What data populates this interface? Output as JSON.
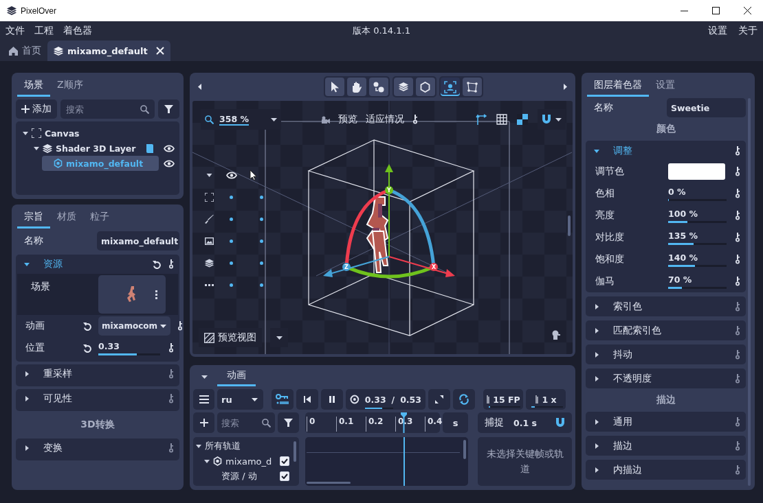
{
  "window": {
    "title": "PixelOver"
  },
  "menu": {
    "left": [
      {
        "label": "文件"
      },
      {
        "label": "工程"
      },
      {
        "label": "着色器"
      }
    ],
    "version": "版本 0.14.1.1",
    "right": [
      {
        "label": "设置"
      },
      {
        "label": "关于"
      }
    ]
  },
  "doc_tabs": [
    {
      "label": "首页",
      "kind": "home",
      "selected": false,
      "closable": false
    },
    {
      "label": "mixamo_default",
      "kind": "layers",
      "selected": true,
      "closable": true
    }
  ],
  "scene_panel": {
    "tabs": [
      {
        "label": "场景",
        "selected": true
      },
      {
        "label": "Z顺序",
        "selected": false
      }
    ],
    "add_button": "添加",
    "search": {
      "placeholder": "搜索"
    },
    "tree": [
      {
        "label": "Canvas",
        "kind": "canvas",
        "expanded": true,
        "selected": false,
        "children": [
          {
            "label": "Shader 3D Layer",
            "kind": "layer",
            "expanded": true,
            "selected": false,
            "visible": true,
            "shader": true,
            "children": [
              {
                "label": "mixamo_default",
                "kind": "model",
                "selected": true,
                "visible": true
              }
            ]
          }
        ]
      }
    ]
  },
  "props_panel": {
    "tabs": [
      {
        "label": "宗旨",
        "selected": true
      },
      {
        "label": "材质",
        "selected": false
      },
      {
        "label": "粒子",
        "selected": false
      }
    ],
    "name": {
      "label": "名称",
      "value": "mixamo_default"
    },
    "sections": [
      {
        "kind": "group",
        "title": "资源",
        "expanded": true,
        "resettable": true,
        "rows": [
          {
            "kind": "thumbnail",
            "label": "场景"
          },
          {
            "kind": "dropdown",
            "label": "动画",
            "value": "mixamocom",
            "resettable": true
          },
          {
            "kind": "slider",
            "label": "位置",
            "value": "0.33",
            "level": 0.62,
            "resettable": true
          }
        ]
      },
      {
        "kind": "group",
        "title": "重采样",
        "expanded": false
      },
      {
        "kind": "group",
        "title": "可见性",
        "expanded": false
      },
      {
        "kind": "header",
        "title": "3D转换"
      },
      {
        "kind": "group",
        "title": "变换",
        "expanded": false
      }
    ]
  },
  "viewport": {
    "tool_groups": [
      {
        "tools": [
          {
            "kind": "pointer",
            "selected": false
          },
          {
            "kind": "hand",
            "selected": false
          },
          {
            "kind": "bones",
            "selected": false
          }
        ]
      },
      {
        "tools": [
          {
            "kind": "layers",
            "selected": false
          },
          {
            "kind": "hexagon",
            "selected": false
          }
        ]
      },
      {
        "tools": [
          {
            "kind": "frame",
            "selected": true
          },
          {
            "kind": "polygon",
            "selected": false
          }
        ]
      }
    ],
    "zoom": {
      "value": "358 %"
    },
    "preview_label": "预览",
    "fit_label": "适应情况",
    "toggles": [
      {
        "kind": "axes",
        "on": true
      },
      {
        "kind": "grid",
        "on": false
      },
      {
        "kind": "checker",
        "on": true
      }
    ],
    "magnet": {
      "on": true
    },
    "view_mode": "预览视图",
    "gizmo_axes": [
      {
        "label": "Y"
      },
      {
        "label": "Z"
      },
      {
        "label": "X"
      }
    ]
  },
  "animation_panel": {
    "tabs": [
      {
        "label": "动画",
        "selected": true
      }
    ],
    "animation": "ru",
    "record": true,
    "time": {
      "current": "0.33",
      "separator": "/",
      "total": "0.53",
      "level": 0.62
    },
    "loop": true,
    "fps": {
      "value": "15 FP",
      "level": 0.05
    },
    "speed": {
      "value": "1 x",
      "level": 0.1
    },
    "search": {
      "placeholder": "搜索"
    },
    "ruler": {
      "ticks": [
        "0",
        "0.1",
        "0.2",
        "0.3",
        "0.4"
      ],
      "level": 0.73
    },
    "unit": "s",
    "snap": {
      "label": "捕捉",
      "value": "0.1 s",
      "on": true
    },
    "tracks": [
      {
        "label": "所有轨道",
        "expanded": true,
        "children": [
          {
            "label": "mixamo_d",
            "kind": "model",
            "expanded": true,
            "checked": true,
            "children": [
              {
                "label": "资源 / 动",
                "checked": true
              }
            ]
          }
        ]
      }
    ],
    "empty_message": "未选择关键帧或轨道"
  },
  "shader_panel": {
    "tabs": [
      {
        "label": "图层着色器",
        "selected": true
      },
      {
        "label": "设置",
        "selected": false
      }
    ],
    "name": {
      "label": "名称",
      "value": "Sweetie"
    },
    "sections": [
      {
        "kind": "header",
        "title": "颜色"
      },
      {
        "kind": "group",
        "title": "调整",
        "expanded": true,
        "rows": [
          {
            "kind": "color",
            "label": "调节色",
            "color": "#ffffff"
          },
          {
            "kind": "slider",
            "label": "色相",
            "value": "0 %",
            "level": 0
          },
          {
            "kind": "slider",
            "label": "亮度",
            "value": "100 %",
            "level": 0.33
          },
          {
            "kind": "slider",
            "label": "对比度",
            "value": "135 %",
            "level": 0.44
          },
          {
            "kind": "slider",
            "label": "饱和度",
            "value": "140 %",
            "level": 0.46
          },
          {
            "kind": "slider",
            "label": "伽马",
            "value": "70 %",
            "level": 0.23
          }
        ]
      },
      {
        "kind": "group",
        "title": "索引色",
        "expanded": false
      },
      {
        "kind": "group",
        "title": "匹配索引色",
        "expanded": false
      },
      {
        "kind": "group",
        "title": "抖动",
        "expanded": false
      },
      {
        "kind": "group",
        "title": "不透明度",
        "expanded": false
      },
      {
        "kind": "header",
        "title": "描边"
      },
      {
        "kind": "group",
        "title": "通用",
        "expanded": false
      },
      {
        "kind": "group",
        "title": "描边",
        "expanded": false
      },
      {
        "kind": "group",
        "title": "内描边",
        "expanded": false
      }
    ]
  }
}
